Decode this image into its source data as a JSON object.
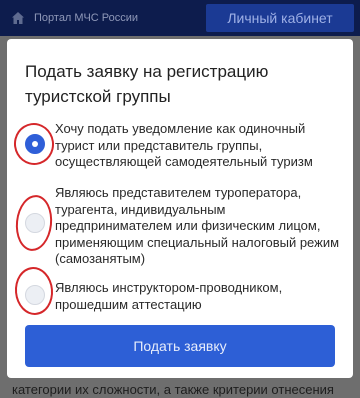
{
  "header": {
    "portal_name": "Портал МЧС России",
    "cabinet_label": "Личный кабинет"
  },
  "modal": {
    "title": "Подать заявку на регистрацию туристской группы",
    "options": [
      {
        "label": "Хочу подать уведомление как одиночный турист или представитель группы, осуществляющей самодеятельный туризм",
        "selected": true
      },
      {
        "label": "Являюсь представителем туроператора, турагента, индивидуальным предпринимателем или физическим лицом, применяющим специальный налоговый режим (самозанятым)",
        "selected": false
      },
      {
        "label": "Являюсь инструктором-проводником, прошедшим аттестацию",
        "selected": false
      }
    ],
    "submit_label": "Подать заявку"
  },
  "background": {
    "partial_text": "категории их сложности, а также критерии отнесения"
  },
  "colors": {
    "accent": "#2d5fd6",
    "header_bg": "#0d1c4d",
    "annotation_red": "#d5272a"
  }
}
